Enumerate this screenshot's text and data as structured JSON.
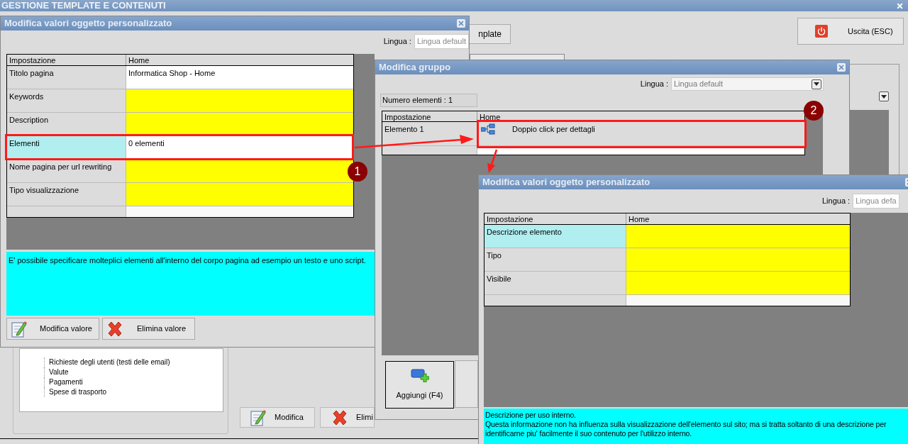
{
  "app": {
    "title": "GESTIONE TEMPLATE E CONTENUTI"
  },
  "background": {
    "template_button": "nplate",
    "exit_button": "Uscita (ESC)",
    "tree_items": [
      "Richieste degli utenti (testi delle email)",
      "Valute",
      "Pagamenti",
      "Spese di trasporto"
    ],
    "buttons": [
      "Modifica",
      "Elimi"
    ]
  },
  "values_dialog": {
    "title": "Modifica valori oggetto personalizzato",
    "language_label": "Lingua :",
    "language_value": "Lingua default",
    "columns": [
      "Impostazione",
      "Home"
    ],
    "rows": [
      {
        "setting": "Titolo pagina",
        "value": "Informatica Shop - Home",
        "selected": false,
        "highlighted": false
      },
      {
        "setting": "Keywords",
        "selected": false,
        "highlighted": true
      },
      {
        "setting": "Description",
        "selected": false,
        "highlighted": true
      },
      {
        "setting": "Elementi",
        "value": "0 elementi",
        "selected": true,
        "highlighted": false
      },
      {
        "setting": "Nome pagina per url rewriting",
        "selected": false,
        "highlighted": true
      },
      {
        "setting": "Tipo visualizzazione",
        "selected": false,
        "highlighted": true
      }
    ],
    "help": [
      "E' possibile specificare molteplici elementi all'interno del corpo pagina ad esempio un testo e uno script."
    ],
    "buttons": [
      "Modifica valore",
      "Elimina valore"
    ]
  },
  "group_dialog": {
    "title": "Modifica gruppo",
    "language_label": "Lingua :",
    "language_value": "Lingua default",
    "count": "Numero elementi : 1",
    "columns": [
      "Impostazione",
      "Home"
    ],
    "rows": [
      {
        "setting": "Elemento 1",
        "value": "Doppio click per dettagli"
      }
    ],
    "add_button": "Aggiungi (F4)"
  },
  "element_dialog": {
    "title": "Modifica valori oggetto personalizzato",
    "language_label": "Lingua :",
    "language_value": "Lingua defa",
    "columns": [
      "Impostazione",
      "Home"
    ],
    "rows": [
      {
        "setting": "Descrizione elemento",
        "selected": true,
        "highlighted": true
      },
      {
        "setting": "Tipo",
        "selected": false,
        "highlighted": true
      },
      {
        "setting": "Visibile",
        "selected": false,
        "highlighted": true
      }
    ],
    "help": [
      "Descrizione per uso interno.",
      "Questa informazione non ha influenza sulla visualizzazione dell'elemento sul sito; ma si tratta soltanto di una descrizione per",
      "identificarne piu' facilmente il suo contenuto per l'utilizzo interno."
    ]
  },
  "annotations": [
    {
      "label": "1"
    },
    {
      "label": "2"
    }
  ]
}
